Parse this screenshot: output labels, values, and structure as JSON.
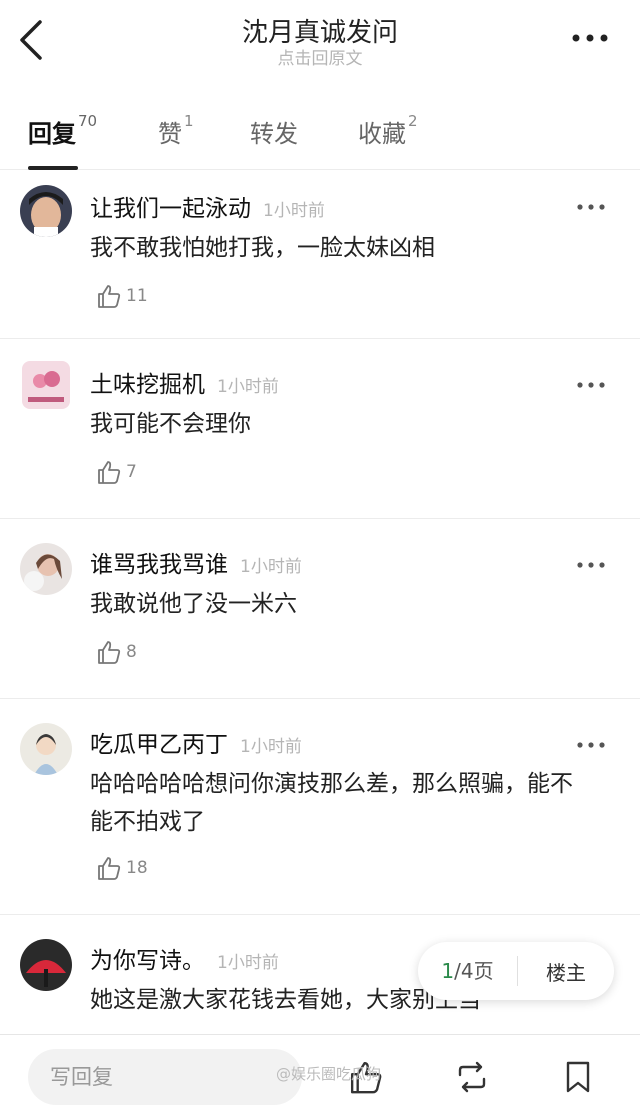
{
  "header": {
    "title": "沈月真诚发问",
    "subtitle": "点击回原文"
  },
  "tabs": [
    {
      "label": "回复",
      "count": "70"
    },
    {
      "label": "赞",
      "count": "1"
    },
    {
      "label": "转发",
      "count": ""
    },
    {
      "label": "收藏",
      "count": "2"
    }
  ],
  "comments": [
    {
      "author": "让我们一起泳动",
      "time": "1小时前",
      "text": "我不敢我怕她打我，一脸太妹凶相",
      "likes": "11"
    },
    {
      "author": "土味挖掘机",
      "time": "1小时前",
      "text": "我可能不会理你",
      "likes": "7"
    },
    {
      "author": "谁骂我我骂谁",
      "time": "1小时前",
      "text": "我敢说他了没一米六",
      "likes": "8"
    },
    {
      "author": "吃瓜甲乙丙丁",
      "time": "1小时前",
      "text": "哈哈哈哈哈想问你演技那么差，那么照骗，能不能不拍戏了",
      "likes": "18"
    },
    {
      "author": "为你写诗。",
      "time": "1小时前",
      "text": "她这是激大家花钱去看她，大家别上当",
      "likes": ""
    }
  ],
  "pager": {
    "current": "1",
    "rest": "/4页",
    "op_label": "楼主"
  },
  "bottom": {
    "reply_placeholder": "写回复"
  },
  "watermark": "@娱乐圈吃瓜狗",
  "colors": {
    "accent_green": "#2a8a4a",
    "text_gray": "#b5b5b5"
  }
}
